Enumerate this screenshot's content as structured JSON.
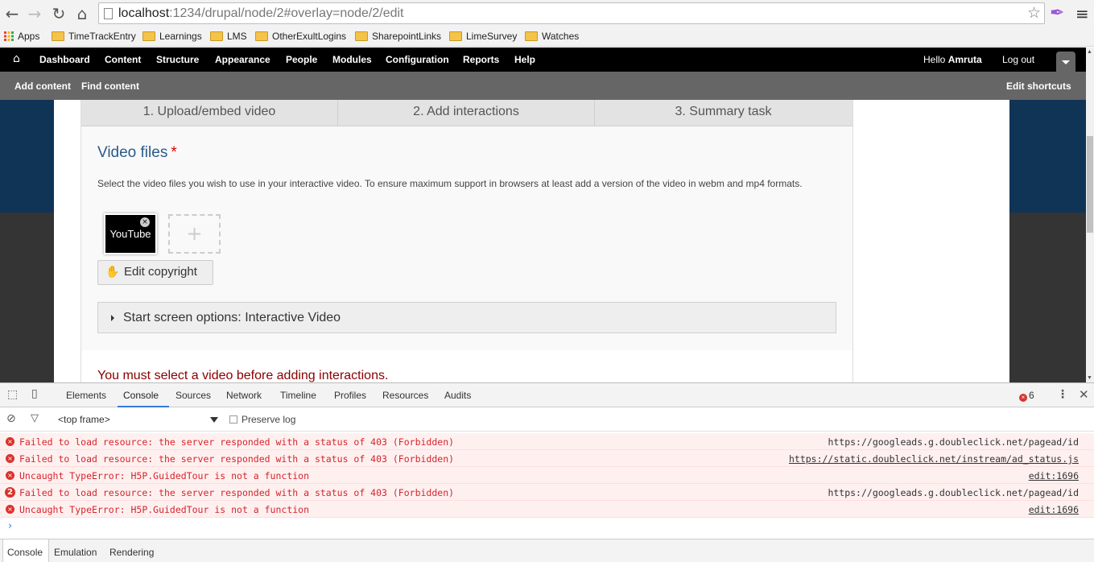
{
  "browser": {
    "url_host": "localhost",
    "url_rest": ":1234/drupal/node/2#overlay=node/2/edit",
    "bookmarks": [
      "Apps",
      "TimeTrackEntry",
      "Learnings",
      "LMS",
      "OtherExultLogins",
      "SharepointLinks",
      "LimeSurvey",
      "Watches"
    ]
  },
  "toolbar": {
    "items": [
      "Dashboard",
      "Content",
      "Structure",
      "Appearance",
      "People",
      "Modules",
      "Configuration",
      "Reports",
      "Help"
    ],
    "hello": "Hello",
    "user": "Amruta",
    "logout": "Log out"
  },
  "shortcuts": {
    "items": [
      "Add content",
      "Find content"
    ],
    "edit": "Edit shortcuts"
  },
  "editor": {
    "steps": [
      "1. Upload/embed video",
      "2. Add interactions",
      "3. Summary task"
    ],
    "video_files_title": "Video files",
    "required_mark": "*",
    "description": "Select the video files you wish to use in your interactive video. To ensure maximum support in browsers at least add a version of the video in webm and mp4 formats.",
    "thumbnail_label": "YouTube",
    "add_symbol": "+",
    "edit_copyright": "Edit copyright",
    "start_screen": "Start screen options: Interactive Video",
    "error_message": "You must select a video before adding interactions."
  },
  "devtools": {
    "tabs": [
      "Elements",
      "Console",
      "Sources",
      "Network",
      "Timeline",
      "Profiles",
      "Resources",
      "Audits"
    ],
    "active_tab": "Console",
    "error_count": "6",
    "frame": "<top frame>",
    "preserve_log": "Preserve log",
    "messages": [
      {
        "text": "Failed to load resource: the server responded with a status of 403 (Forbidden)",
        "source": "https://googleads.g.doubleclick.net/pagead/id",
        "link": false,
        "count": ""
      },
      {
        "text": "Failed to load resource: the server responded with a status of 403 (Forbidden)",
        "source": "https://static.doubleclick.net/instream/ad_status.js",
        "link": true,
        "count": ""
      },
      {
        "text": "Uncaught TypeError: H5P.GuidedTour is not a function",
        "source": "edit:1696",
        "link": true,
        "count": ""
      },
      {
        "text": "Failed to load resource: the server responded with a status of 403 (Forbidden)",
        "source": "https://googleads.g.doubleclick.net/pagead/id",
        "link": false,
        "count": "2"
      },
      {
        "text": "Uncaught TypeError: H5P.GuidedTour is not a function",
        "source": "edit:1696",
        "link": true,
        "count": ""
      }
    ],
    "prompt": "›",
    "drawer_tabs": [
      "Console",
      "Emulation",
      "Rendering"
    ]
  },
  "colors": {
    "toolbar_bg": "#000000",
    "shortcut_bg": "#666666",
    "title_blue": "#2a5a8a",
    "error_red": "#d6242a",
    "devtools_accent": "#3879d9"
  }
}
